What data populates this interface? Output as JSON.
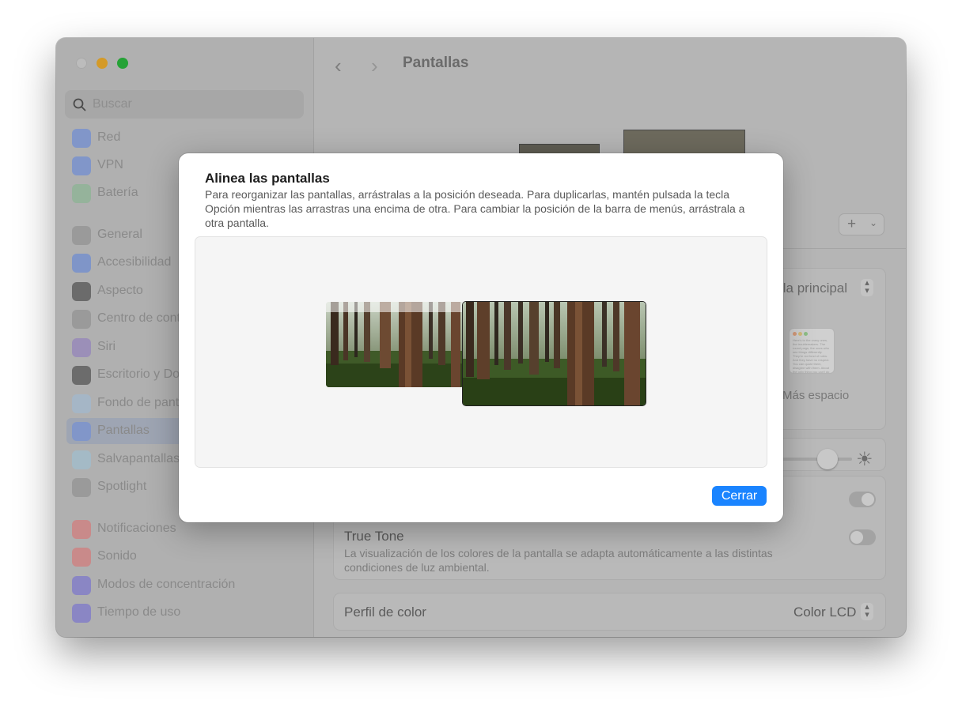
{
  "window": {
    "title": "Pantallas",
    "search_placeholder": "Buscar"
  },
  "sidebar": {
    "items": [
      {
        "label": "Red",
        "icon": "globe-icon",
        "color": "#8196c9"
      },
      {
        "label": "VPN",
        "icon": "vpn-globe-icon",
        "color": "#8196c9"
      },
      {
        "label": "Batería",
        "icon": "battery-icon",
        "color": "#95b39b"
      },
      {
        "label": "General",
        "icon": "gear-icon",
        "color": "#9a9a9a"
      },
      {
        "label": "Accesibilidad",
        "icon": "accessibility-icon",
        "color": "#7f95c8"
      },
      {
        "label": "Aspecto",
        "icon": "appearance-icon",
        "color": "#6b6b6b"
      },
      {
        "label": "Centro de control",
        "icon": "control-center-icon",
        "color": "#9a9a9a"
      },
      {
        "label": "Siri",
        "icon": "siri-icon",
        "color": "#9b8fb8"
      },
      {
        "label": "Escritorio y Dock",
        "icon": "dock-icon",
        "color": "#6c6c6c"
      },
      {
        "label": "Fondo de pantalla",
        "icon": "wallpaper-icon",
        "color": "#a5b6c6"
      },
      {
        "label": "Pantallas",
        "icon": "sun-icon",
        "color": "#8196c9",
        "selected": true
      },
      {
        "label": "Salvapantallas",
        "icon": "screensaver-icon",
        "color": "#a4bac6"
      },
      {
        "label": "Spotlight",
        "icon": "spotlight-icon",
        "color": "#9a9a9a"
      },
      {
        "label": "Notificaciones",
        "icon": "bell-icon",
        "color": "#c98a8a"
      },
      {
        "label": "Sonido",
        "icon": "speaker-icon",
        "color": "#c98a8a"
      },
      {
        "label": "Modos de concentración",
        "icon": "moon-icon",
        "color": "#8a86c4"
      },
      {
        "label": "Tiempo de uso",
        "icon": "hourglass-icon",
        "color": "#8a86c4"
      }
    ]
  },
  "main": {
    "add_button": "+",
    "main_display_label": "lla principal",
    "more_space_label": "Más espacio",
    "mini_window_text": "Here's to the crazy ones, the troublemakers. The round pegs, the ones who see things differently. They're not fond of rules. And they have no respect. You can quote them, disagree with them. About the only thing you can't do is ignore them. Because they change things.",
    "brightness_level": 0.7,
    "auto_brightness_on": true,
    "true_tone": {
      "title": "True Tone",
      "description": "La visualización de los colores de la pantalla se adapta automáticamente a las distintas condiciones de luz ambiental.",
      "on": false
    },
    "color_profile": {
      "label": "Perfil de color",
      "value": "Color LCD"
    }
  },
  "modal": {
    "title": "Alinea las pantallas",
    "description": "Para reorganizar las pantallas, arrástralas a la posición deseada. Para duplicarlas, mantén pulsada la tecla Opción mientras las arrastras una encima de otra. Para cambiar la posición de la barra de menús, arrástrala a otra pantalla.",
    "close_button": "Cerrar",
    "accent_color": "#1a84ff"
  }
}
